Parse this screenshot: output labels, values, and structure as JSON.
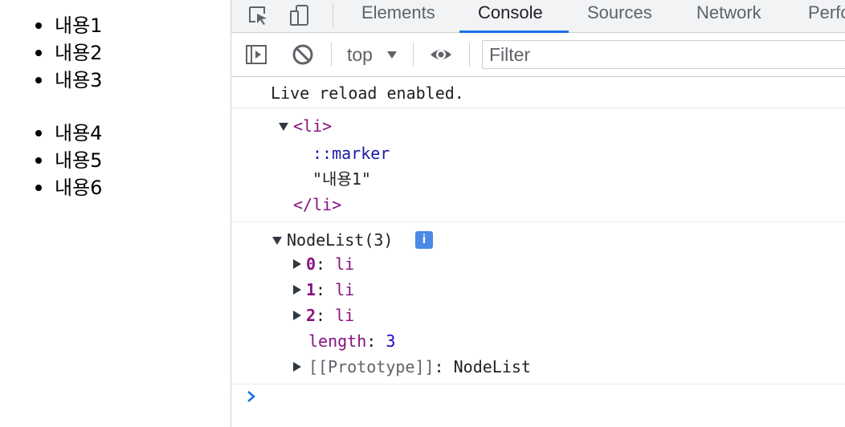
{
  "page": {
    "list1": [
      "내용1",
      "내용2",
      "내용3"
    ],
    "list2": [
      "내용4",
      "내용5",
      "내용6"
    ]
  },
  "devtools": {
    "tabs": [
      "Elements",
      "Console",
      "Sources",
      "Network",
      "Perfo"
    ],
    "active_tab": "Console",
    "toolbar": {
      "context": "top",
      "filter_placeholder": "Filter"
    },
    "console": {
      "live_reload": "Live reload enabled.",
      "element": {
        "open_tag": "<li>",
        "marker": "::marker",
        "text": "\"내용1\"",
        "close_tag": "</li>"
      },
      "nodelist": {
        "header": "NodeList(3)",
        "info_icon": "i",
        "items": [
          {
            "key": "0",
            "value": "li"
          },
          {
            "key": "1",
            "value": "li"
          },
          {
            "key": "2",
            "value": "li"
          }
        ],
        "length_key": "length",
        "length_value": "3",
        "prototype_key": "[[Prototype]]",
        "prototype_value": "NodeList"
      }
    },
    "colors": {
      "accent": "#1a73e8",
      "tag": "#881280",
      "number": "#1c00cf",
      "pseudo": "#1a1aa6"
    }
  }
}
